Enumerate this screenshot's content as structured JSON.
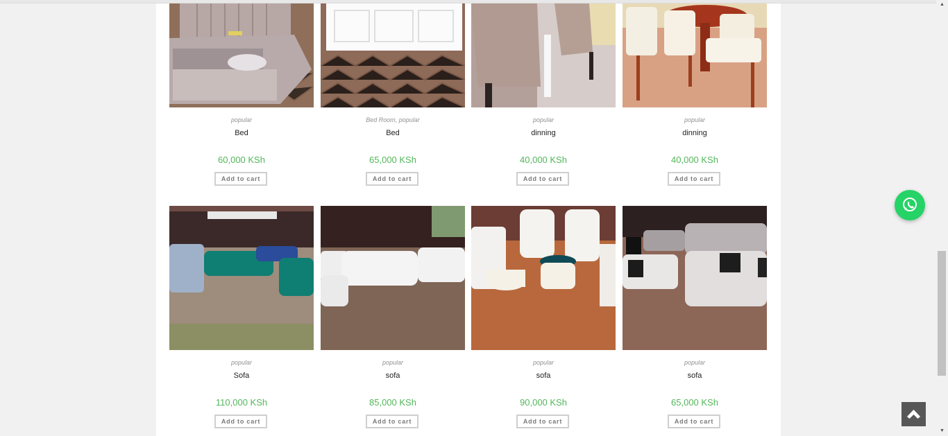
{
  "products": [
    {
      "category": "popular",
      "title": "Bed",
      "price": "60,000 KSh",
      "button": "Add to cart"
    },
    {
      "category": "Bed Room, popular",
      "title": "Bed",
      "price": "65,000 KSh",
      "button": "Add to cart"
    },
    {
      "category": "popular",
      "title": "dinning",
      "price": "40,000 KSh",
      "button": "Add to cart"
    },
    {
      "category": "popular",
      "title": "dinning",
      "price": "40,000 KSh",
      "button": "Add to cart"
    },
    {
      "category": "popular",
      "title": "Sofa",
      "price": "110,000 KSh",
      "button": "Add to cart"
    },
    {
      "category": "popular",
      "title": "sofa",
      "price": "85,000 KSh",
      "button": "Add to cart"
    },
    {
      "category": "popular",
      "title": "sofa",
      "price": "90,000 KSh",
      "button": "Add to cart"
    },
    {
      "category": "popular",
      "title": "sofa",
      "price": "65,000 KSh",
      "button": "Add to cart"
    }
  ],
  "icons": {
    "whatsapp": "whatsapp-icon",
    "back_to_top": "chevron-up-icon"
  },
  "colors": {
    "price": "#52b65a",
    "whatsapp": "#25d366"
  }
}
